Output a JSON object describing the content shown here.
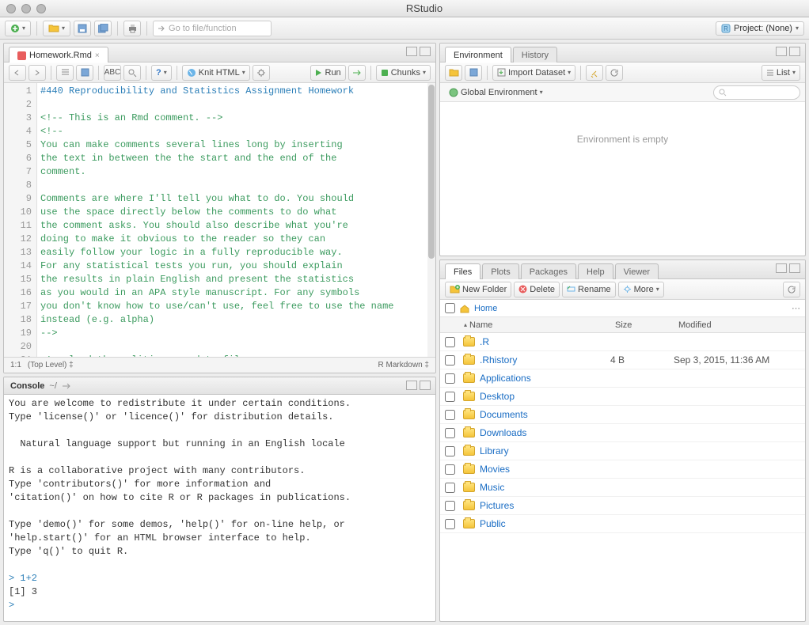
{
  "app_title": "RStudio",
  "main_toolbar": {
    "goto_placeholder": "Go to file/function",
    "project_label": "Project: (None)"
  },
  "editor": {
    "tab_label": "Homework.Rmd",
    "knit_label": "Knit HTML",
    "run_label": "Run",
    "chunks_label": "Chunks",
    "status_pos": "1:1",
    "status_scope": "(Top Level)",
    "status_mode": "R Markdown",
    "lines": [
      {
        "n": 1,
        "cls": "tok-h",
        "t": "#440 Reproducibility and Statistics Assignment Homework"
      },
      {
        "n": 2,
        "cls": "",
        "t": ""
      },
      {
        "n": 3,
        "cls": "tok-c",
        "t": "<!-- This is an Rmd comment. -->"
      },
      {
        "n": 4,
        "cls": "tok-c",
        "t": "<!--"
      },
      {
        "n": 5,
        "cls": "tok-c",
        "t": "You can make comments several lines long by inserting"
      },
      {
        "n": 6,
        "cls": "tok-c",
        "t": "the text in between the the start and the end of the"
      },
      {
        "n": 7,
        "cls": "tok-c",
        "t": "comment."
      },
      {
        "n": 8,
        "cls": "tok-c",
        "t": ""
      },
      {
        "n": 9,
        "cls": "tok-c",
        "t": "Comments are where I'll tell you what to do. You should"
      },
      {
        "n": 10,
        "cls": "tok-c",
        "t": "use the space directly below the comments to do what"
      },
      {
        "n": 11,
        "cls": "tok-c",
        "t": "the comment asks. You should also describe what you're"
      },
      {
        "n": 12,
        "cls": "tok-c",
        "t": "doing to make it obvious to the reader so they can"
      },
      {
        "n": 13,
        "cls": "tok-c",
        "t": "easily follow your logic in a fully reproducible way."
      },
      {
        "n": 14,
        "cls": "tok-c",
        "t": "For any statistical tests you run, you should explain"
      },
      {
        "n": 15,
        "cls": "tok-c",
        "t": "the results in plain English and present the statistics"
      },
      {
        "n": 16,
        "cls": "tok-c",
        "t": "as you would in an APA style manuscript. For any symbols"
      },
      {
        "n": 17,
        "cls": "tok-c",
        "t": "you don't know how to use/can't use, feel free to use the name"
      },
      {
        "n": 18,
        "cls": "tok-c",
        "t": "instead (e.g. alpha)"
      },
      {
        "n": 19,
        "cls": "tok-c",
        "t": "-->"
      },
      {
        "n": 20,
        "cls": "",
        "t": ""
      },
      {
        "n": 21,
        "cls": "tok-c",
        "t": "<!-- load the politics csv data file  -->"
      }
    ]
  },
  "console": {
    "title": "Console",
    "wd": "~/",
    "text": "You are welcome to redistribute it under certain conditions.\nType 'license()' or 'licence()' for distribution details.\n\n  Natural language support but running in an English locale\n\nR is a collaborative project with many contributors.\nType 'contributors()' for more information and\n'citation()' on how to cite R or R packages in publications.\n\nType 'demo()' for some demos, 'help()' for on-line help, or\n'help.start()' for an HTML browser interface to help.\nType 'q()' to quit R.\n",
    "input_line": "1+2",
    "output_line": "[1] 3",
    "prompt": ">"
  },
  "env": {
    "tabs": [
      "Environment",
      "History"
    ],
    "import_label": "Import Dataset",
    "list_label": "List",
    "scope_label": "Global Environment",
    "empty_text": "Environment is empty"
  },
  "files": {
    "tabs": [
      "Files",
      "Plots",
      "Packages",
      "Help",
      "Viewer"
    ],
    "newfolder_label": "New Folder",
    "delete_label": "Delete",
    "rename_label": "Rename",
    "more_label": "More",
    "breadcrumb_home": "Home",
    "cols": {
      "name": "Name",
      "size": "Size",
      "modified": "Modified"
    },
    "rows": [
      {
        "name": ".R",
        "size": "",
        "mod": ""
      },
      {
        "name": ".Rhistory",
        "size": "4 B",
        "mod": "Sep 3, 2015, 11:36 AM"
      },
      {
        "name": "Applications",
        "size": "",
        "mod": ""
      },
      {
        "name": "Desktop",
        "size": "",
        "mod": ""
      },
      {
        "name": "Documents",
        "size": "",
        "mod": ""
      },
      {
        "name": "Downloads",
        "size": "",
        "mod": ""
      },
      {
        "name": "Library",
        "size": "",
        "mod": ""
      },
      {
        "name": "Movies",
        "size": "",
        "mod": ""
      },
      {
        "name": "Music",
        "size": "",
        "mod": ""
      },
      {
        "name": "Pictures",
        "size": "",
        "mod": ""
      },
      {
        "name": "Public",
        "size": "",
        "mod": ""
      }
    ]
  }
}
